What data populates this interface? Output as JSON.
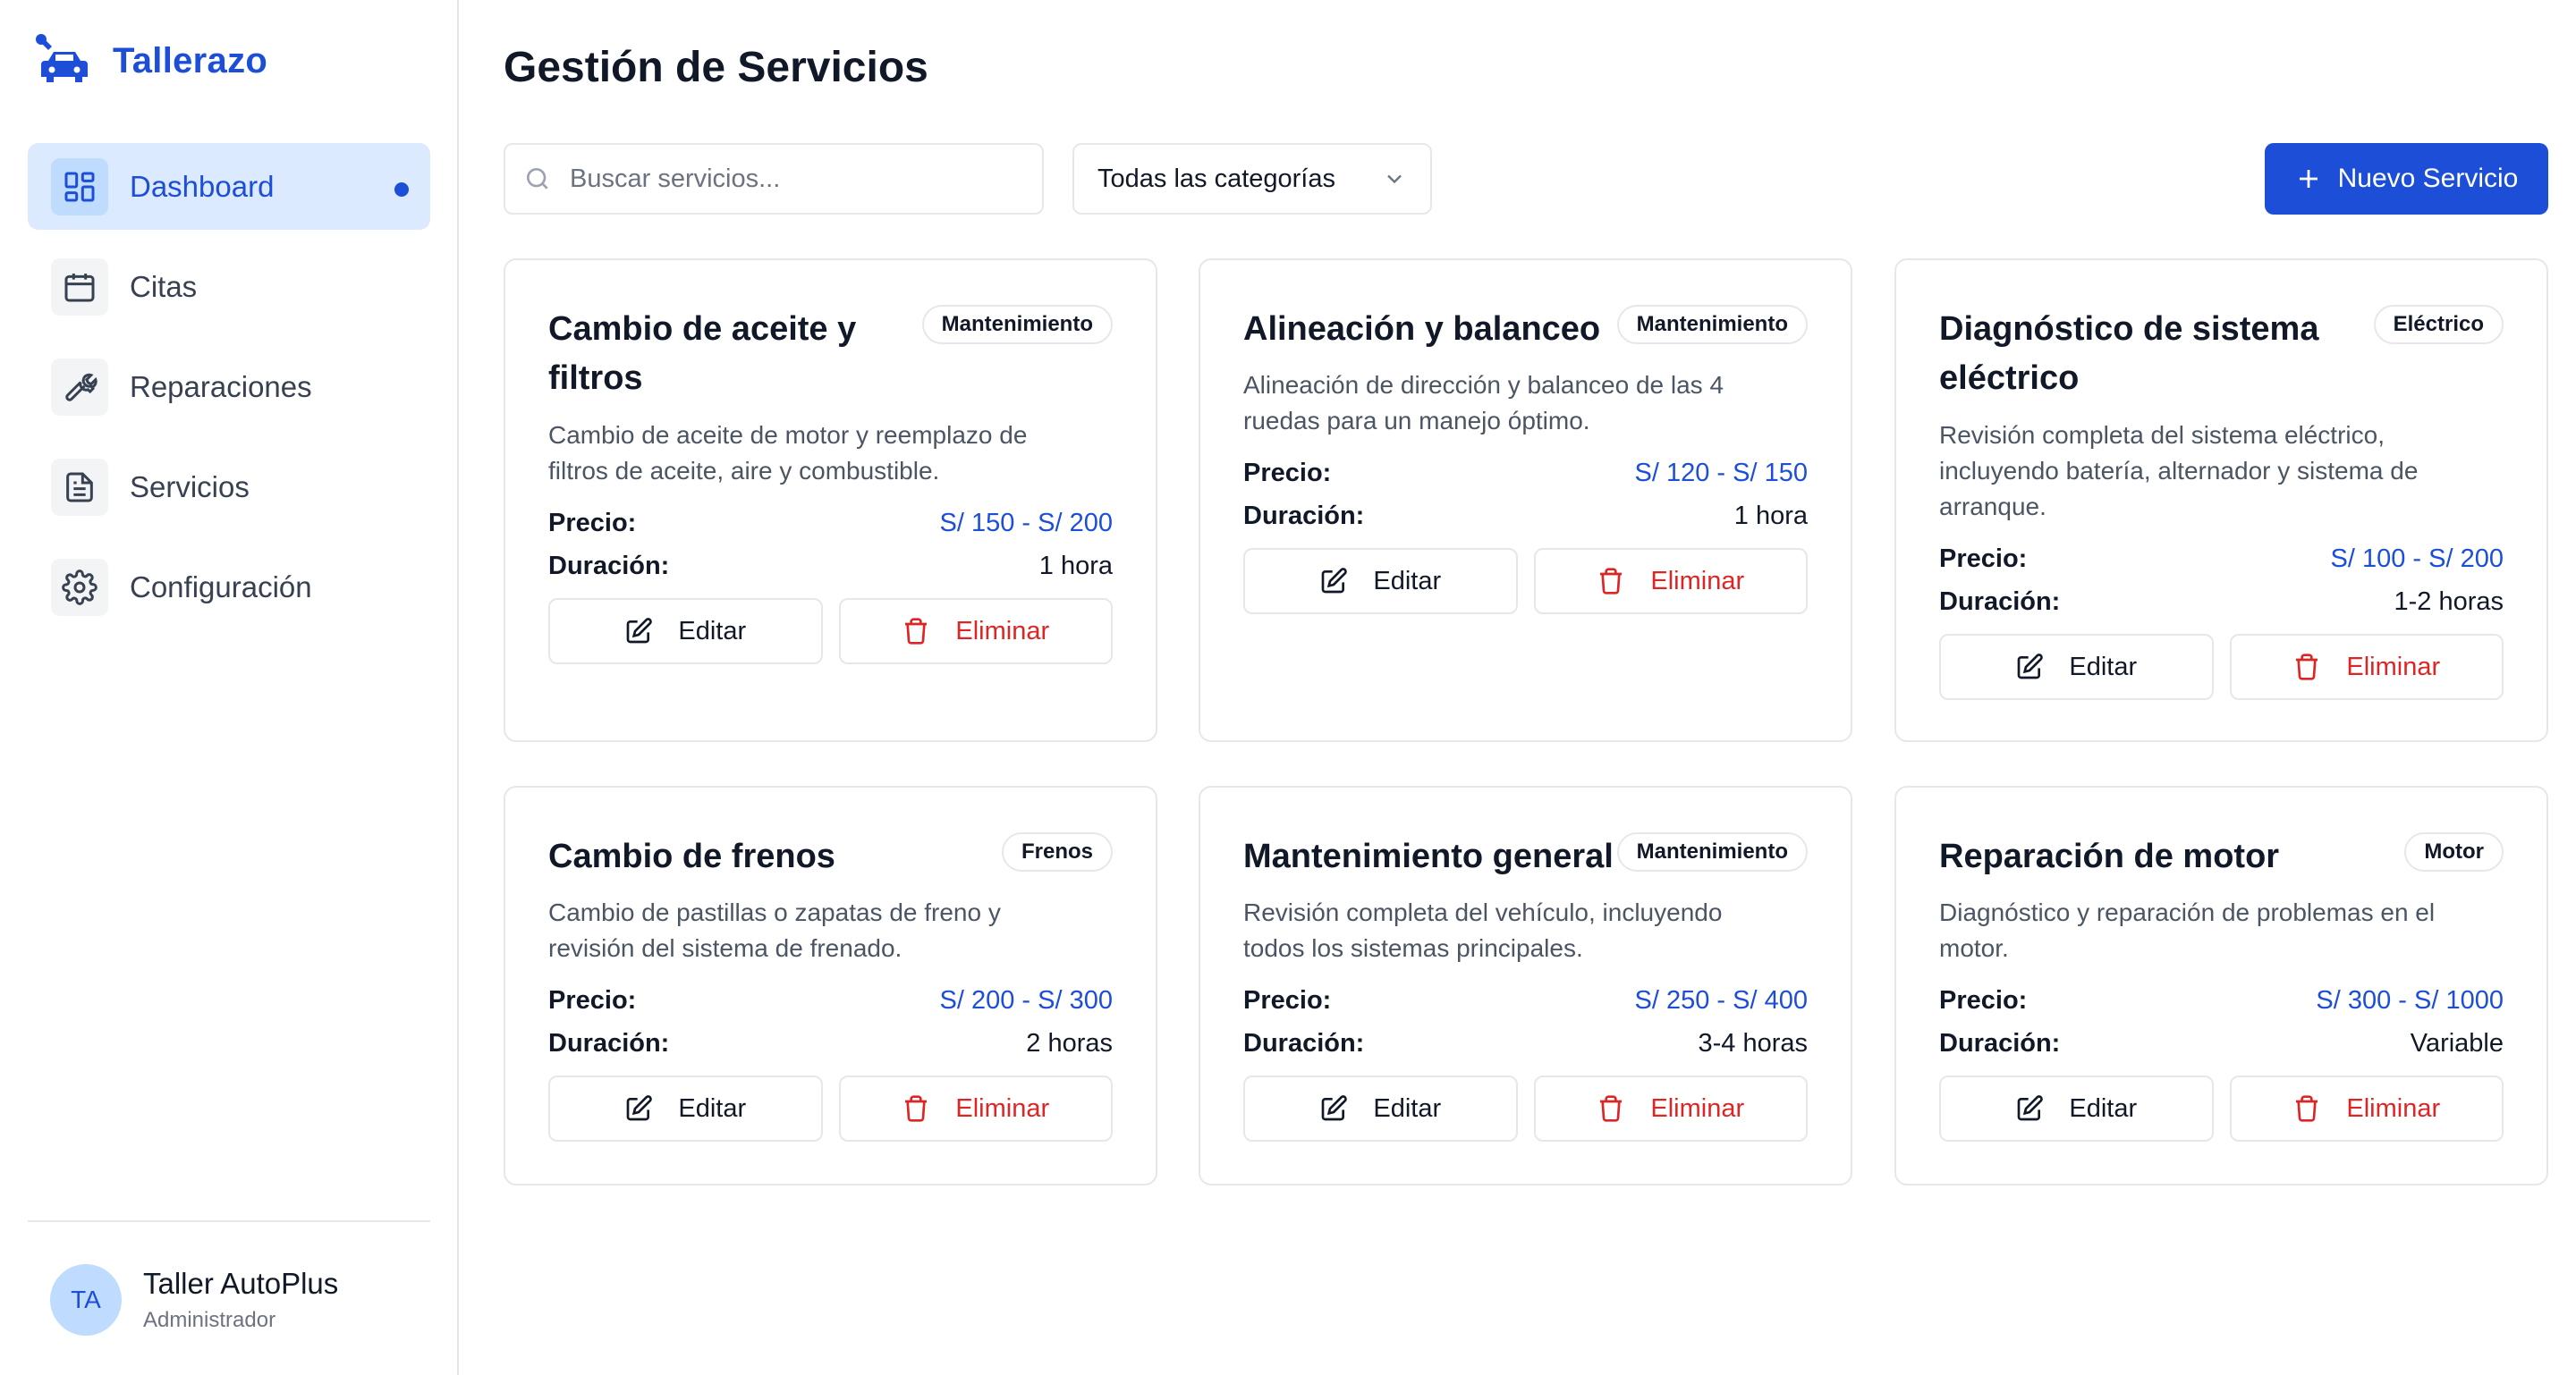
{
  "app": {
    "name": "Tallerazo",
    "brand_icon": "car-wrench-icon"
  },
  "sidebar": {
    "items": [
      {
        "label": "Dashboard",
        "icon": "dashboard-grid-icon",
        "active": true
      },
      {
        "label": "Citas",
        "icon": "calendar-icon",
        "active": false
      },
      {
        "label": "Reparaciones",
        "icon": "wrench-icon",
        "active": false
      },
      {
        "label": "Servicios",
        "icon": "document-icon",
        "active": false
      },
      {
        "label": "Configuración",
        "icon": "gear-icon",
        "active": false
      }
    ],
    "user": {
      "initials": "TA",
      "name": "Taller AutoPlus",
      "role": "Administrador"
    }
  },
  "main": {
    "title": "Gestión de Servicios",
    "search": {
      "placeholder": "Buscar servicios..."
    },
    "filter": {
      "selected": "Todas las categorías"
    },
    "new_button": "Nuevo Servicio",
    "labels": {
      "price": "Precio:",
      "duration": "Duración:",
      "edit": "Editar",
      "delete": "Eliminar"
    },
    "services": [
      {
        "title_lines": [
          "Cambio de aceite y",
          "filtros"
        ],
        "badge": "Mantenimiento",
        "desc_lines": [
          "Cambio de aceite de motor y reemplazo de",
          "filtros de aceite, aire y combustible."
        ],
        "price": "S/ 150 - S/ 200",
        "duration": "1 hora"
      },
      {
        "title_lines": [
          "Alineación y balanceo"
        ],
        "badge": "Mantenimiento",
        "desc_lines": [
          "Alineación de dirección y balanceo de las 4",
          "ruedas para un manejo óptimo."
        ],
        "price": "S/ 120 - S/ 150",
        "duration": "1 hora"
      },
      {
        "title_lines": [
          "Diagnóstico de sistema",
          "eléctrico"
        ],
        "badge": "Eléctrico",
        "desc_lines": [
          "Revisión completa del sistema eléctrico,",
          "incluyendo batería, alternador y sistema de",
          "arranque."
        ],
        "price": "S/ 100 - S/ 200",
        "duration": "1-2 horas"
      },
      {
        "title_lines": [
          "Cambio de frenos"
        ],
        "badge": "Frenos",
        "desc_lines": [
          "Cambio de pastillas o zapatas de freno y",
          "revisión del sistema de frenado."
        ],
        "price": "S/ 200 - S/ 300",
        "duration": "2 horas"
      },
      {
        "title_lines": [
          "Mantenimiento general"
        ],
        "badge": "Mantenimiento",
        "desc_lines": [
          "Revisión completa del vehículo, incluyendo",
          "todos los sistemas principales."
        ],
        "price": "S/ 250 - S/ 400",
        "duration": "3-4 horas"
      },
      {
        "title_lines": [
          "Reparación de motor"
        ],
        "badge": "Motor",
        "desc_lines": [
          "Diagnóstico y reparación de problemas en el",
          "motor."
        ],
        "price": "S/ 300 - S/ 1000",
        "duration": "Variable"
      }
    ]
  }
}
